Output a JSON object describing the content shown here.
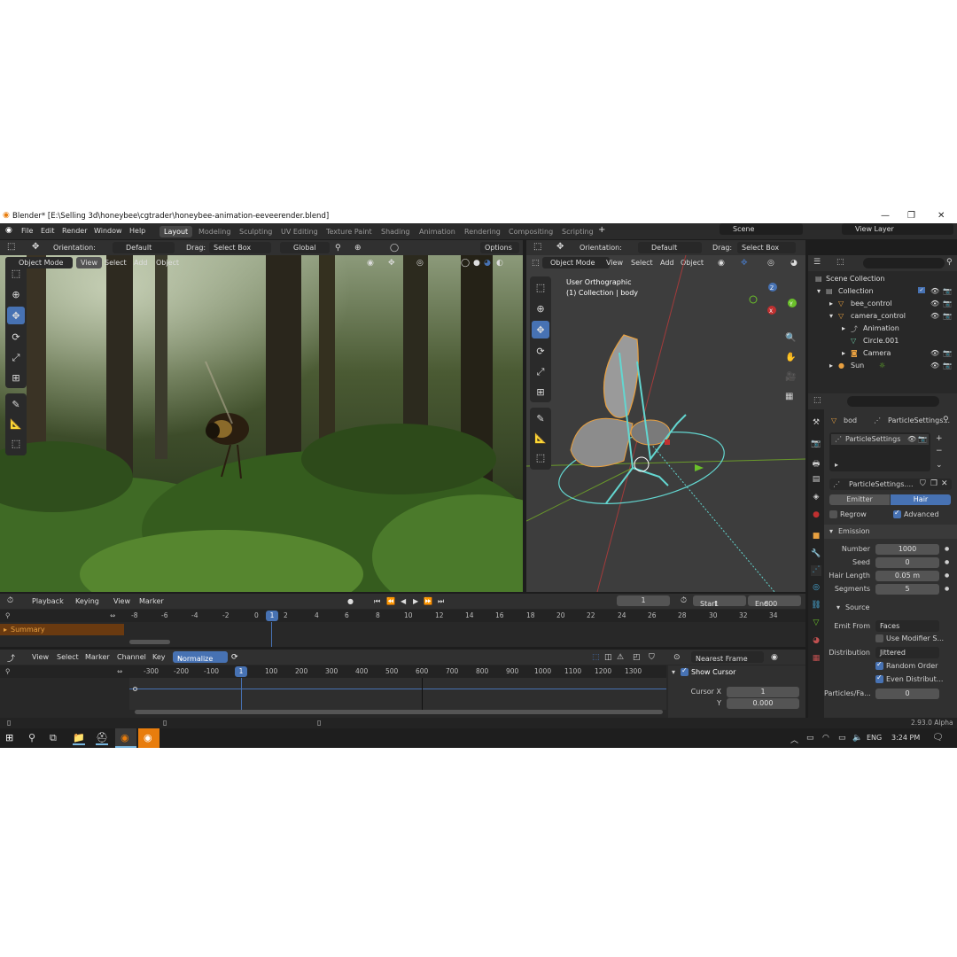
{
  "window": {
    "title": "Blender* [E:\\Selling 3d\\honeybee\\cgtrader\\honeybee-animation-eeveerender.blend]"
  },
  "menu": [
    "File",
    "Edit",
    "Render",
    "Window",
    "Help"
  ],
  "workspaces": [
    "Layout",
    "Modeling",
    "Sculpting",
    "UV Editing",
    "Texture Paint",
    "Shading",
    "Animation",
    "Rendering",
    "Compositing",
    "Scripting"
  ],
  "scene": {
    "name": "Scene",
    "view_layer": "View Layer"
  },
  "tool_header_left": {
    "orientation_label": "Orientation:",
    "orientation": "Default",
    "drag_label": "Drag:",
    "drag": "Select Box",
    "transform": "Global",
    "options": "Options"
  },
  "tool_header_right": {
    "orientation_label": "Orientation:",
    "orientation": "Default",
    "drag_label": "Drag:",
    "drag": "Select Box"
  },
  "viewport_left": {
    "mode": "Object Mode",
    "menu": [
      "View",
      "Select",
      "Add",
      "Object"
    ]
  },
  "viewport_right": {
    "mode": "Object Mode",
    "menu": [
      "View",
      "Select",
      "Add",
      "Object"
    ],
    "overlay_line1": "User Orthographic",
    "overlay_line2": "(1) Collection | body"
  },
  "outliner": {
    "rows": [
      {
        "label": "Scene Collection",
        "indent": 0
      },
      {
        "label": "Collection",
        "indent": 1
      },
      {
        "label": "bee_control",
        "indent": 2
      },
      {
        "label": "camera_control",
        "indent": 2
      },
      {
        "label": "Animation",
        "indent": 3
      },
      {
        "label": "Circle.001",
        "indent": 3
      },
      {
        "label": "Camera",
        "indent": 2
      },
      {
        "label": "Sun",
        "indent": 1
      }
    ]
  },
  "properties": {
    "object": "bod",
    "settings_name": "ParticleSettings...",
    "list_item": "ParticleSettings",
    "datablock": "ParticleSettings....",
    "type_emitter": "Emitter",
    "type_hair": "Hair",
    "regrow": "Regrow",
    "advanced": "Advanced",
    "emission_title": "Emission",
    "number_label": "Number",
    "number": "1000",
    "seed_label": "Seed",
    "seed": "0",
    "hair_length_label": "Hair Length",
    "hair_length": "0.05 m",
    "segments_label": "Segments",
    "segments": "5",
    "source_title": "Source",
    "emit_from_label": "Emit From",
    "emit_from": "Faces",
    "use_modifier": "Use Modifier S...",
    "distribution_label": "Distribution",
    "distribution": "Jittered",
    "random_order": "Random Order",
    "even_distrib": "Even Distribut...",
    "particles_label": "Particles/Fa...",
    "particles": "0"
  },
  "timeline": {
    "menu": [
      "Playback",
      "Keying",
      "View",
      "Marker"
    ],
    "current_frame": "1",
    "start_label": "Start",
    "start": "1",
    "end_label": "End",
    "end": "600",
    "ticks": [
      "-8",
      "-6",
      "-4",
      "-2",
      "0",
      "2",
      "4",
      "6",
      "8",
      "10",
      "12",
      "14",
      "16",
      "18",
      "20",
      "22",
      "24",
      "26",
      "28",
      "30",
      "32",
      "34"
    ],
    "summary": "Summary"
  },
  "graph": {
    "menu": [
      "View",
      "Select",
      "Marker",
      "Channel",
      "Key"
    ],
    "normalize": "Normalize",
    "snap": "Nearest Frame",
    "ticks": [
      "-300",
      "-200",
      "-100",
      "1",
      "100",
      "200",
      "300",
      "400",
      "500",
      "600",
      "700",
      "800",
      "900",
      "1000",
      "1100",
      "1200",
      "1300"
    ],
    "show_cursor": "Show Cursor",
    "cursor_x_label": "Cursor X",
    "cursor_x": "1",
    "y_label": "Y",
    "y": "0.000"
  },
  "status": {
    "version": "2.93.0 Alpha"
  },
  "taskbar": {
    "lang": "ENG",
    "time": "3:24 PM"
  }
}
